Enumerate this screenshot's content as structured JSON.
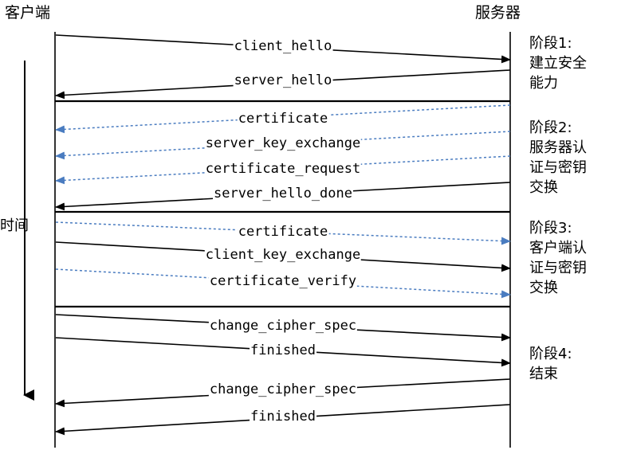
{
  "client_label": "客户端",
  "server_label": "服务器",
  "time_label": "时间",
  "phases": [
    {
      "title": "阶段1:",
      "desc": "建立安全能力"
    },
    {
      "title": "阶段2:",
      "desc": "服务器认证与密钥交换"
    },
    {
      "title": "阶段3:",
      "desc": "客户端认证与密钥交换"
    },
    {
      "title": "阶段4:",
      "desc": "结束"
    }
  ],
  "messages": [
    {
      "label": "client_hello",
      "direction": "to-server",
      "style": "solid"
    },
    {
      "label": "server_hello",
      "direction": "to-client",
      "style": "solid"
    },
    {
      "label": "certificate",
      "direction": "to-client",
      "style": "dashed"
    },
    {
      "label": "server_key_exchange",
      "direction": "to-client",
      "style": "dashed"
    },
    {
      "label": "certificate_request",
      "direction": "to-client",
      "style": "dashed"
    },
    {
      "label": "server_hello_done",
      "direction": "to-client",
      "style": "solid"
    },
    {
      "label": "certificate",
      "direction": "to-server",
      "style": "dashed"
    },
    {
      "label": "client_key_exchange",
      "direction": "to-server",
      "style": "solid"
    },
    {
      "label": "certificate_verify",
      "direction": "to-server",
      "style": "dashed"
    },
    {
      "label": "change_cipher_spec",
      "direction": "to-server",
      "style": "solid"
    },
    {
      "label": "finished",
      "direction": "to-server",
      "style": "solid"
    },
    {
      "label": "change_cipher_spec",
      "direction": "to-client",
      "style": "solid"
    },
    {
      "label": "finished",
      "direction": "to-client",
      "style": "solid"
    }
  ],
  "colors": {
    "solid": "#000000",
    "dashed": "#4a7cc0"
  }
}
